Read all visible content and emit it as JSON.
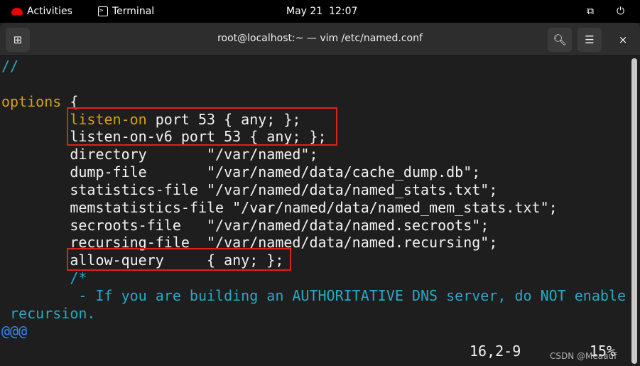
{
  "topbar": {
    "activities": "Activities",
    "app": "Terminal",
    "clock": "May 21  12:07",
    "icons": [
      "redhat-icon",
      "terminal-icon",
      "network-icon",
      "power-icon"
    ]
  },
  "window": {
    "title": "root@localhost:~ — vim /etc/named.conf",
    "close": "×"
  },
  "colors": {
    "comment": "#27a9c4",
    "keyword": "#d4a017",
    "text": "#f2f2f2",
    "highlight_box": "#e0201c"
  },
  "lines": [
    [
      {
        "t": "//",
        "c": "comment"
      }
    ],
    [],
    [
      {
        "t": "options",
        "c": "keyword"
      },
      {
        "t": " {",
        "c": ""
      }
    ],
    [
      {
        "t": "        ",
        "c": ""
      },
      {
        "t": "listen-on",
        "c": "keyword"
      },
      {
        "t": " port 53 { any; };",
        "c": ""
      }
    ],
    [
      {
        "t": "        listen-on-v6 port 53 { any; };",
        "c": ""
      }
    ],
    [
      {
        "t": "        directory       \"/var/named\";",
        "c": ""
      }
    ],
    [
      {
        "t": "        dump-file       \"/var/named/data/cache_dump.db\";",
        "c": ""
      }
    ],
    [
      {
        "t": "        statistics-file \"/var/named/data/named_stats.txt\";",
        "c": ""
      }
    ],
    [
      {
        "t": "        memstatistics-file \"/var/named/data/named_mem_stats.txt\";",
        "c": ""
      }
    ],
    [
      {
        "t": "        secroots-file   \"/var/named/data/named.secroots\";",
        "c": ""
      }
    ],
    [
      {
        "t": "        recursing-file  \"/var/named/data/named.recursing\";",
        "c": ""
      }
    ],
    [
      {
        "t": "        allow-query     { any; };",
        "c": ""
      }
    ],
    [
      {
        "t": "        /*",
        "c": "comment"
      }
    ],
    [
      {
        "t": "         - If you are building an AUTHORITATIVE DNS server, do NOT enable",
        "c": "comment"
      }
    ],
    [
      {
        "t": " recursion.",
        "c": "comment"
      }
    ],
    [
      {
        "t": "@@@",
        "c": "tilde"
      }
    ]
  ],
  "status": {
    "position": "16,2-9",
    "percent": "15%"
  },
  "watermark": "CSDN @Meaauf"
}
